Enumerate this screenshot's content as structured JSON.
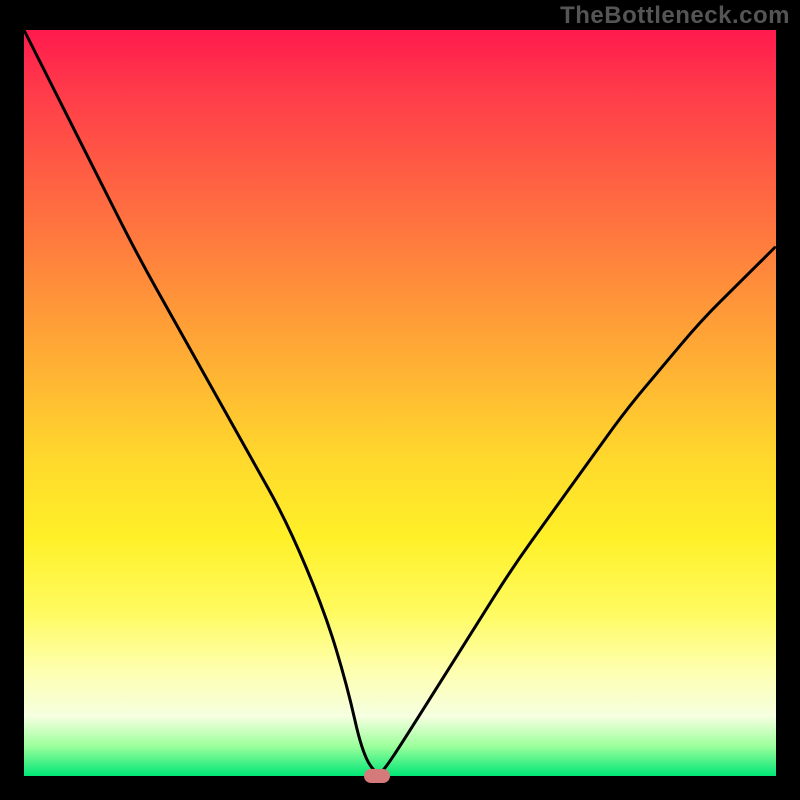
{
  "watermark": "TheBottleneck.com",
  "chart_data": {
    "type": "line",
    "title": "",
    "xlabel": "",
    "ylabel": "",
    "xlim": [
      0,
      100
    ],
    "ylim": [
      0,
      100
    ],
    "grid": false,
    "legend": false,
    "series": [
      {
        "name": "curve",
        "x": [
          0,
          5,
          10,
          15,
          20,
          25,
          30,
          35,
          40,
          43,
          45,
          47,
          48,
          50,
          55,
          60,
          65,
          70,
          75,
          80,
          85,
          90,
          95,
          100
        ],
        "y": [
          100,
          90,
          80,
          70,
          61,
          52,
          43,
          34,
          22,
          12,
          3,
          0,
          1,
          4,
          12,
          20,
          28,
          35,
          42,
          49,
          55,
          61,
          66,
          71
        ]
      }
    ],
    "marker": {
      "x": 47,
      "y": 0
    },
    "gradient_stops": [
      {
        "pos": 0,
        "color": "#ff1a4d"
      },
      {
        "pos": 50,
        "color": "#ffba32"
      },
      {
        "pos": 80,
        "color": "#fffb60"
      },
      {
        "pos": 100,
        "color": "#00e676"
      }
    ]
  }
}
